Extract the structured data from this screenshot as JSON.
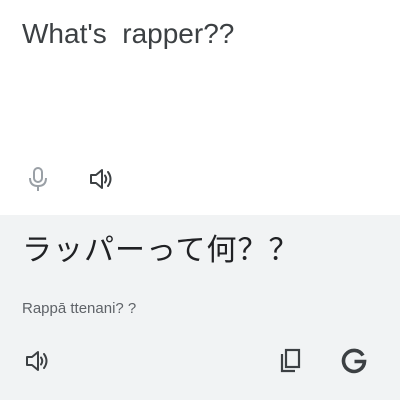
{
  "source": {
    "text": "What's  rapper??",
    "mic_icon": "microphone-icon",
    "speak_icon": "speaker-icon"
  },
  "target": {
    "text": "ラッパーって何？？",
    "transliteration": "Rappā ttenani? ?",
    "speak_icon": "speaker-icon",
    "copy_icon": "copy-icon",
    "google_icon": "google-g-icon"
  },
  "colors": {
    "source_bg": "#ffffff",
    "target_bg": "#f1f3f4",
    "icon_gray": "#5f6368",
    "mic_disabled": "#9aa0a6",
    "text": "#202124"
  }
}
